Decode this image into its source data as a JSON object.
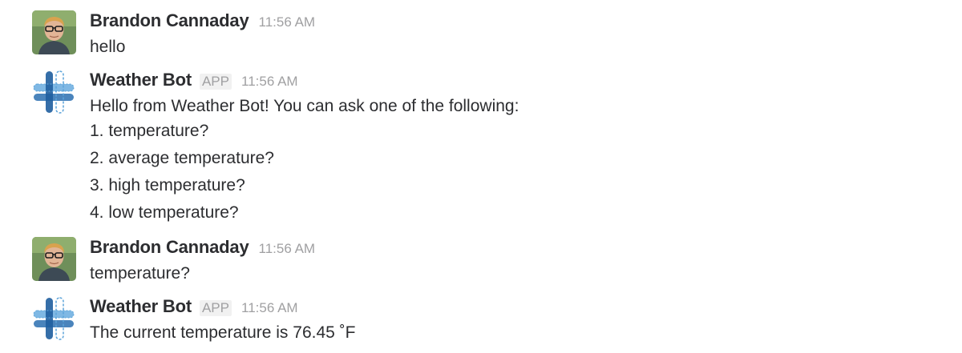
{
  "messages": [
    {
      "sender": "Brandon Cannaday",
      "time": "11:56 AM",
      "lines": [
        "hello"
      ]
    },
    {
      "sender": "Weather Bot",
      "badge": "APP",
      "time": "11:56 AM",
      "lines": [
        "Hello from Weather Bot! You can ask one of the following:",
        "1. temperature?",
        "2. average temperature?",
        "3. high temperature?",
        "4. low temperature?"
      ]
    },
    {
      "sender": "Brandon Cannaday",
      "time": "11:56 AM",
      "lines": [
        "temperature?"
      ]
    },
    {
      "sender": "Weather Bot",
      "badge": "APP",
      "time": "11:56 AM",
      "lines": [
        "The current temperature is 76.45 ˚F"
      ]
    }
  ],
  "icons": {
    "user_avatar": "user-avatar-photo",
    "bot_avatar": "hashtag-bot-icon"
  },
  "colors": {
    "bot_blue_light": "#5ba3d9",
    "bot_blue_dark": "#2a6fb0",
    "timestamp": "#a0a0a2"
  }
}
